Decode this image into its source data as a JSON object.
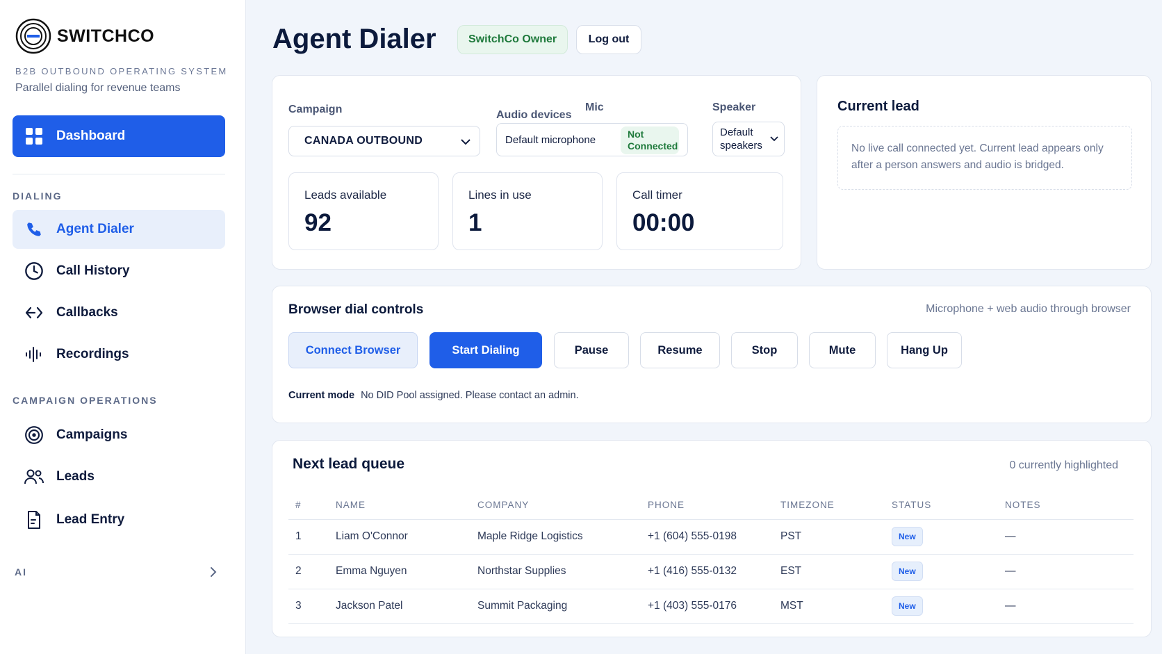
{
  "sidebar": {
    "brand": "SWITCHCO",
    "tagline": "B2B OUTBOUND OPERATING SYSTEM",
    "subline": "Parallel dialing for revenue teams",
    "dashboard": "Dashboard",
    "sections": {
      "dialing": "DIALING",
      "campaign_ops": "CAMPAIGN OPERATIONS",
      "ai": "AI"
    },
    "dialing_items": [
      {
        "label": "Agent Dialer",
        "icon": "phone-icon",
        "active": true
      },
      {
        "label": "Call History",
        "icon": "clock-icon"
      },
      {
        "label": "Callbacks",
        "icon": "callback-arrows-icon"
      },
      {
        "label": "Recordings",
        "icon": "waveform-icon"
      }
    ],
    "campaign_items": [
      {
        "label": "Campaigns",
        "icon": "target-icon"
      },
      {
        "label": "Leads",
        "icon": "users-icon"
      },
      {
        "label": "Lead Entry",
        "icon": "document-edit-icon"
      }
    ]
  },
  "header": {
    "title": "Agent Dialer",
    "role": "SwitchCo Owner",
    "logout": "Log out"
  },
  "config": {
    "campaign_label": "Campaign",
    "campaign_value": "CANADA OUTBOUND",
    "audio_label": "Audio devices",
    "mic_label": "Mic",
    "mic_value": "Default microphone",
    "mic_status_1": "Not",
    "mic_status_2": "Connected",
    "speaker_label": "Speaker",
    "speaker_value_1": "Default",
    "speaker_value_2": "speakers",
    "stats": [
      {
        "title": "Leads available",
        "value": "92"
      },
      {
        "title": "Lines in use",
        "value": "1"
      },
      {
        "title": "Call timer",
        "value": "00:00"
      }
    ]
  },
  "current_lead": {
    "title": "Current lead",
    "empty_text": "No live call connected yet. Current lead appears only after a person answers and audio is bridged."
  },
  "controls": {
    "title": "Browser dial controls",
    "note": "Microphone + web audio through browser",
    "buttons": [
      "Connect Browser",
      "Start Dialing",
      "Pause",
      "Resume",
      "Stop",
      "Mute",
      "Hang Up"
    ],
    "mode_label": "Current mode",
    "mode_text": "No DID Pool assigned. Please contact an admin."
  },
  "queue": {
    "title": "Next lead queue",
    "note": "0 currently highlighted",
    "columns": [
      "#",
      "NAME",
      "COMPANY",
      "PHONE",
      "TIMEZONE",
      "STATUS",
      "NOTES"
    ],
    "rows": [
      {
        "n": "1",
        "name": "Liam O'Connor",
        "company": "Maple Ridge Logistics",
        "phone": "+1 (604) 555-0198",
        "tz": "PST",
        "status": "New",
        "notes": "—"
      },
      {
        "n": "2",
        "name": "Emma Nguyen",
        "company": "Northstar Supplies",
        "phone": "+1 (416) 555-0132",
        "tz": "EST",
        "status": "New",
        "notes": "—"
      },
      {
        "n": "3",
        "name": "Jackson Patel",
        "company": "Summit Packaging",
        "phone": "+1 (403) 555-0176",
        "tz": "MST",
        "status": "New",
        "notes": "—"
      }
    ]
  },
  "colors": {
    "accent": "#1f5ee8",
    "success": "#1f7a3c",
    "background": "#f1f5fb"
  }
}
